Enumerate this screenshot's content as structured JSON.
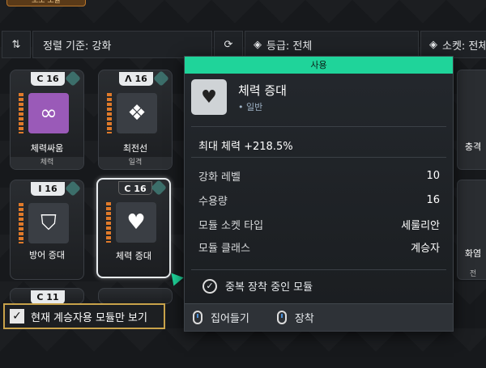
{
  "top_tab": "보조 모듈",
  "toolbar": {
    "sort_label": "정렬 기준: 강화",
    "grade_label": "등급: 전체",
    "socket_label": "소켓: 전체"
  },
  "cards": [
    {
      "capacity": "C 16",
      "name": "체력싸움",
      "category": "체력"
    },
    {
      "capacity": "Λ 16",
      "name": "최전선",
      "category": "일격"
    },
    {
      "capacity": "I 16",
      "name": "방어 증대",
      "category": ""
    },
    {
      "capacity": "C 16",
      "name": "체력 증대",
      "category": ""
    },
    {
      "capacity": "C 11",
      "name": "",
      "category": ""
    },
    {
      "capacity": "",
      "name": "충격",
      "category": ""
    },
    {
      "capacity": "",
      "name": "화염",
      "category": "전"
    }
  ],
  "tooltip": {
    "header": "사용",
    "name": "체력 증대",
    "tier": "• 일반",
    "effect": "최대 체력 +218.5%",
    "stats": [
      {
        "label": "강화 레벨",
        "value": "10"
      },
      {
        "label": "수용량",
        "value": "16"
      },
      {
        "label": "모듈 소켓 타입",
        "value": "세룰리안"
      },
      {
        "label": "모듈 클래스",
        "value": "계승자"
      }
    ],
    "notice": "중복 장착 중인 모듈",
    "actions": {
      "pickup": "집어들기",
      "equip": "장착"
    }
  },
  "filter_label": "현재 계승자용 모듈만 보기",
  "colors": {
    "accent_green": "#1fd49a",
    "filter_border": "#c8a24a",
    "stripe_orange": "#e07a2a"
  }
}
